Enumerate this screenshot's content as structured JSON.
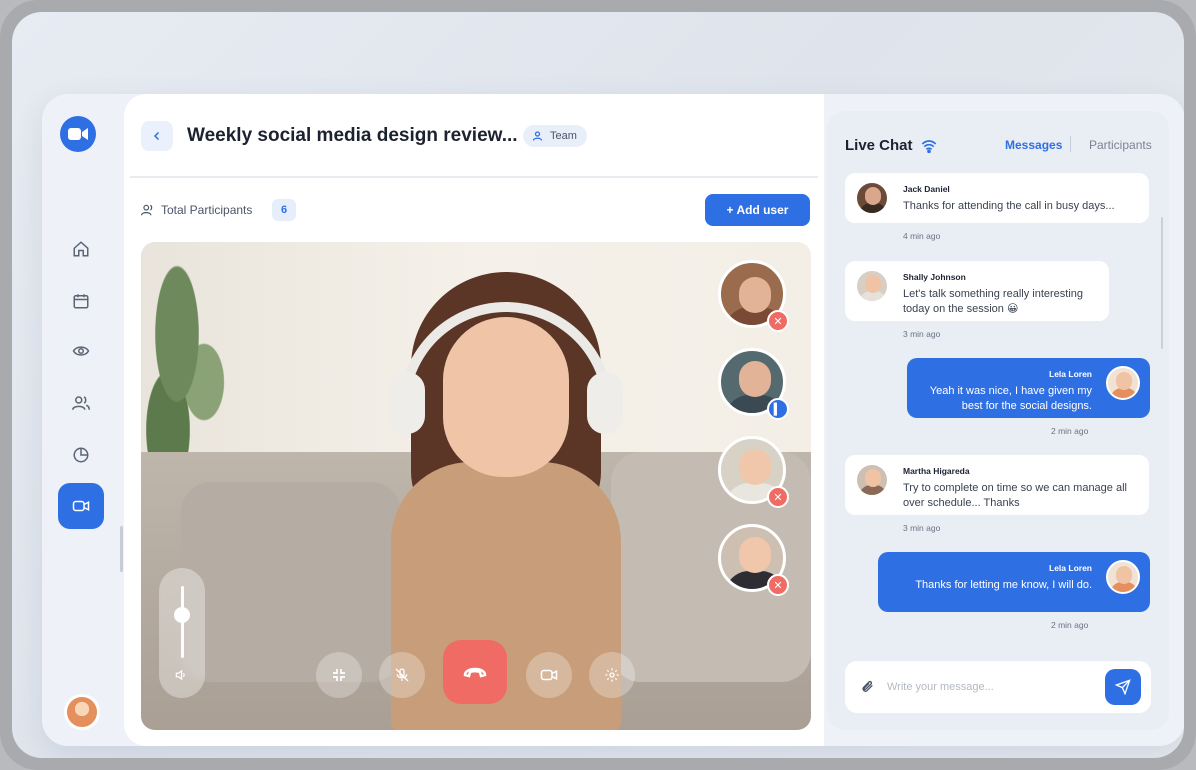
{
  "header": {
    "title": "Weekly social media design review...",
    "tag": "Team"
  },
  "participants": {
    "label": "Total Participants",
    "count": "6",
    "add_button": "+ Add user"
  },
  "sidebar": {
    "items": [
      {
        "icon": "home-icon"
      },
      {
        "icon": "calendar-icon"
      },
      {
        "icon": "eye-icon"
      },
      {
        "icon": "users-icon"
      },
      {
        "icon": "pie-chart-icon"
      },
      {
        "icon": "video-icon",
        "active": true
      }
    ]
  },
  "call": {
    "volume_level": 0.6,
    "controls": [
      "minimize-icon",
      "mic-off-icon",
      "end-call-icon",
      "camera-icon",
      "settings-icon"
    ],
    "tiles": [
      {
        "status": "muted",
        "badge_color": "#ef6b63"
      },
      {
        "status": "speaking",
        "badge_color": "#2f6fe4"
      },
      {
        "status": "muted",
        "badge_color": "#ef6b63"
      },
      {
        "status": "muted",
        "badge_color": "#ef6b63"
      }
    ]
  },
  "chat": {
    "title": "Live Chat",
    "tabs": {
      "messages": "Messages",
      "participants": "Participants"
    },
    "messages": [
      {
        "name": "Jack Daniel",
        "text": "Thanks for attending the call in busy days...",
        "time": "4 min ago",
        "side": "in"
      },
      {
        "name": "Shally Johnson",
        "text": "Let's talk something really interesting today on the session 😀",
        "time": "3 min ago",
        "side": "in"
      },
      {
        "name": "Lela Loren",
        "text": "Yeah it was nice, I have given my best for the social designs.",
        "time": "2 min ago",
        "side": "out"
      },
      {
        "name": "Martha Higareda",
        "text": "Try to complete on time so we can manage all over schedule... Thanks",
        "time": "3 min ago",
        "side": "in"
      },
      {
        "name": "Lela Loren",
        "text": "Thanks for letting me know, I will do.",
        "time": "2 min ago",
        "side": "out"
      }
    ],
    "input_placeholder": "Write your message..."
  },
  "colors": {
    "accent": "#2f6fe4",
    "danger": "#ef6b63"
  }
}
